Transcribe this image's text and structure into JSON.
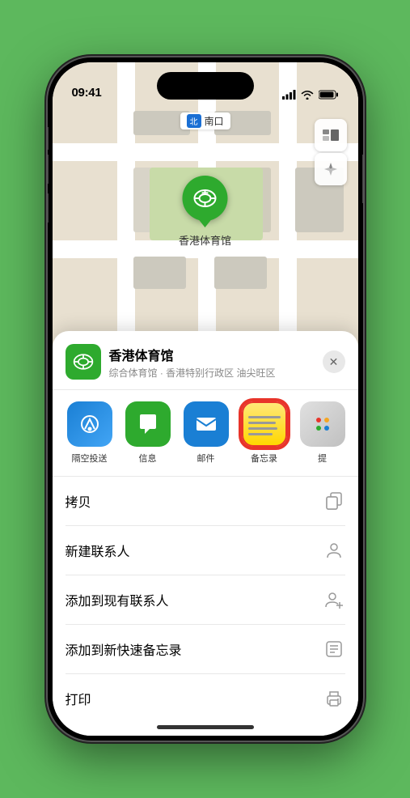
{
  "phone": {
    "time": "09:41",
    "location_label": "南口",
    "map_pin_label": "香港体育馆"
  },
  "location_card": {
    "name": "香港体育馆",
    "desc": "综合体育馆 · 香港特别行政区 油尖旺区",
    "close_label": "✕"
  },
  "share_items": [
    {
      "id": "airdrop",
      "label": "隔空投送",
      "type": "airdrop"
    },
    {
      "id": "message",
      "label": "信息",
      "type": "message"
    },
    {
      "id": "mail",
      "label": "邮件",
      "type": "mail"
    },
    {
      "id": "notes",
      "label": "备忘录",
      "type": "notes"
    },
    {
      "id": "more",
      "label": "提",
      "type": "more"
    }
  ],
  "actions": [
    {
      "id": "copy",
      "label": "拷贝",
      "icon": "copy"
    },
    {
      "id": "new-contact",
      "label": "新建联系人",
      "icon": "person"
    },
    {
      "id": "add-existing",
      "label": "添加到现有联系人",
      "icon": "person-add"
    },
    {
      "id": "add-notes",
      "label": "添加到新快速备忘录",
      "icon": "note"
    },
    {
      "id": "print",
      "label": "打印",
      "icon": "printer"
    }
  ],
  "colors": {
    "green": "#2eaa2e",
    "blue": "#1a7fd4",
    "red": "#e8342a",
    "notes_yellow": "#ffd700"
  }
}
